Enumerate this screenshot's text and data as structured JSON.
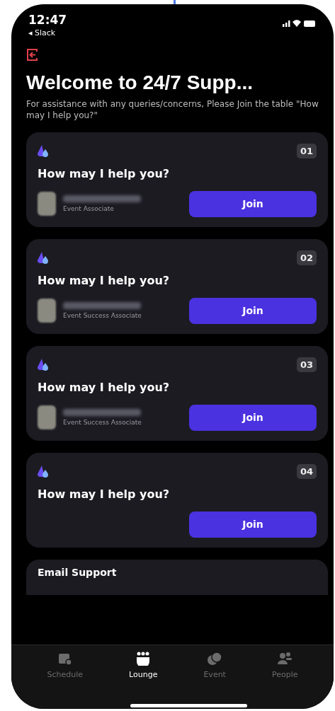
{
  "status_bar": {
    "time": "12:47",
    "back_app": "◂ Slack"
  },
  "title": "Welcome to 24/7 Supp...",
  "subtitle": "For assistance with any queries/concerns, Please Join the table \"How may I help you?\"",
  "tables": [
    {
      "number": "01",
      "title": "How may I help you?",
      "host": {
        "role": "Event Associate"
      },
      "button": "Join"
    },
    {
      "number": "02",
      "title": "How may I help you?",
      "host": {
        "role": "Event Success Associate"
      },
      "button": "Join"
    },
    {
      "number": "03",
      "title": "How may I help you?",
      "host": {
        "role": "Event Success Associate"
      },
      "button": "Join"
    },
    {
      "number": "04",
      "title": "How may I help you?",
      "button": "Join"
    }
  ],
  "partial_card": {
    "title": "Email Support"
  },
  "tab_bar": [
    {
      "kind": "schedule",
      "label": "Schedule",
      "selected": false
    },
    {
      "kind": "lounge",
      "label": "Lounge",
      "selected": true
    },
    {
      "kind": "event",
      "label": "Event",
      "selected": false
    },
    {
      "kind": "people",
      "label": "People",
      "selected": false
    }
  ]
}
